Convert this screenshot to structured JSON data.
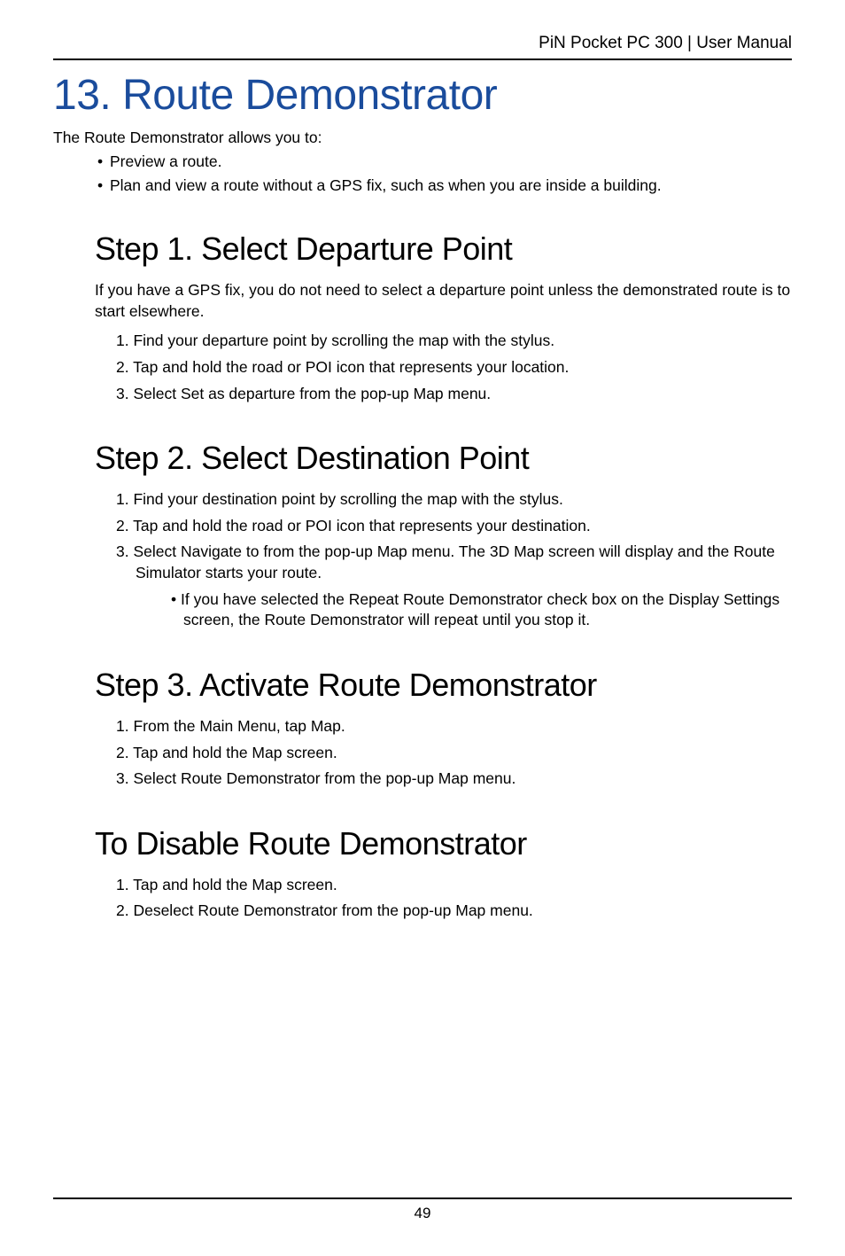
{
  "header": {
    "product": "PiN Pocket PC 300",
    "separator": " | ",
    "docType": "User Manual"
  },
  "chapter": {
    "title": "13. Route Demonstrator",
    "intro": "The Route Demonstrator allows you to:",
    "bullets": [
      "Preview a route.",
      "Plan and view a route without a GPS fix, such as when you are inside a building."
    ]
  },
  "sections": [
    {
      "title": "Step 1. Select Departure Point",
      "intro": "If you have a GPS fix, you do not need to select a departure point unless the demonstrated route is to start elsewhere.",
      "items": [
        "1. Find your departure point by scrolling the map with the stylus.",
        "2. Tap and hold the road or POI icon that represents your location.",
        "3. Select Set as departure from the pop-up Map menu."
      ]
    },
    {
      "title": "Step 2. Select Destination Point",
      "intro": "",
      "items": [
        "1. Find your destination point by scrolling the map with the stylus.",
        "2. Tap and hold the road or POI icon that represents your destination.",
        "3. Select Navigate to from the pop-up Map menu. The 3D Map screen will display and the Route Simulator starts your route."
      ],
      "subBullet": "If you have selected the Repeat Route Demonstrator check box on the Display Settings screen, the Route Demonstrator will repeat until you stop it."
    },
    {
      "title": "Step 3. Activate Route Demonstrator",
      "intro": "",
      "items": [
        "1. From the Main Menu, tap Map.",
        "2. Tap and hold the Map screen.",
        "3. Select Route Demonstrator from the pop-up Map menu."
      ]
    },
    {
      "title": "To Disable Route Demonstrator",
      "intro": "",
      "items": [
        "1. Tap and hold the Map screen.",
        "2. Deselect Route Demonstrator from the pop-up Map menu."
      ]
    }
  ],
  "footer": {
    "pageNumber": "49"
  }
}
